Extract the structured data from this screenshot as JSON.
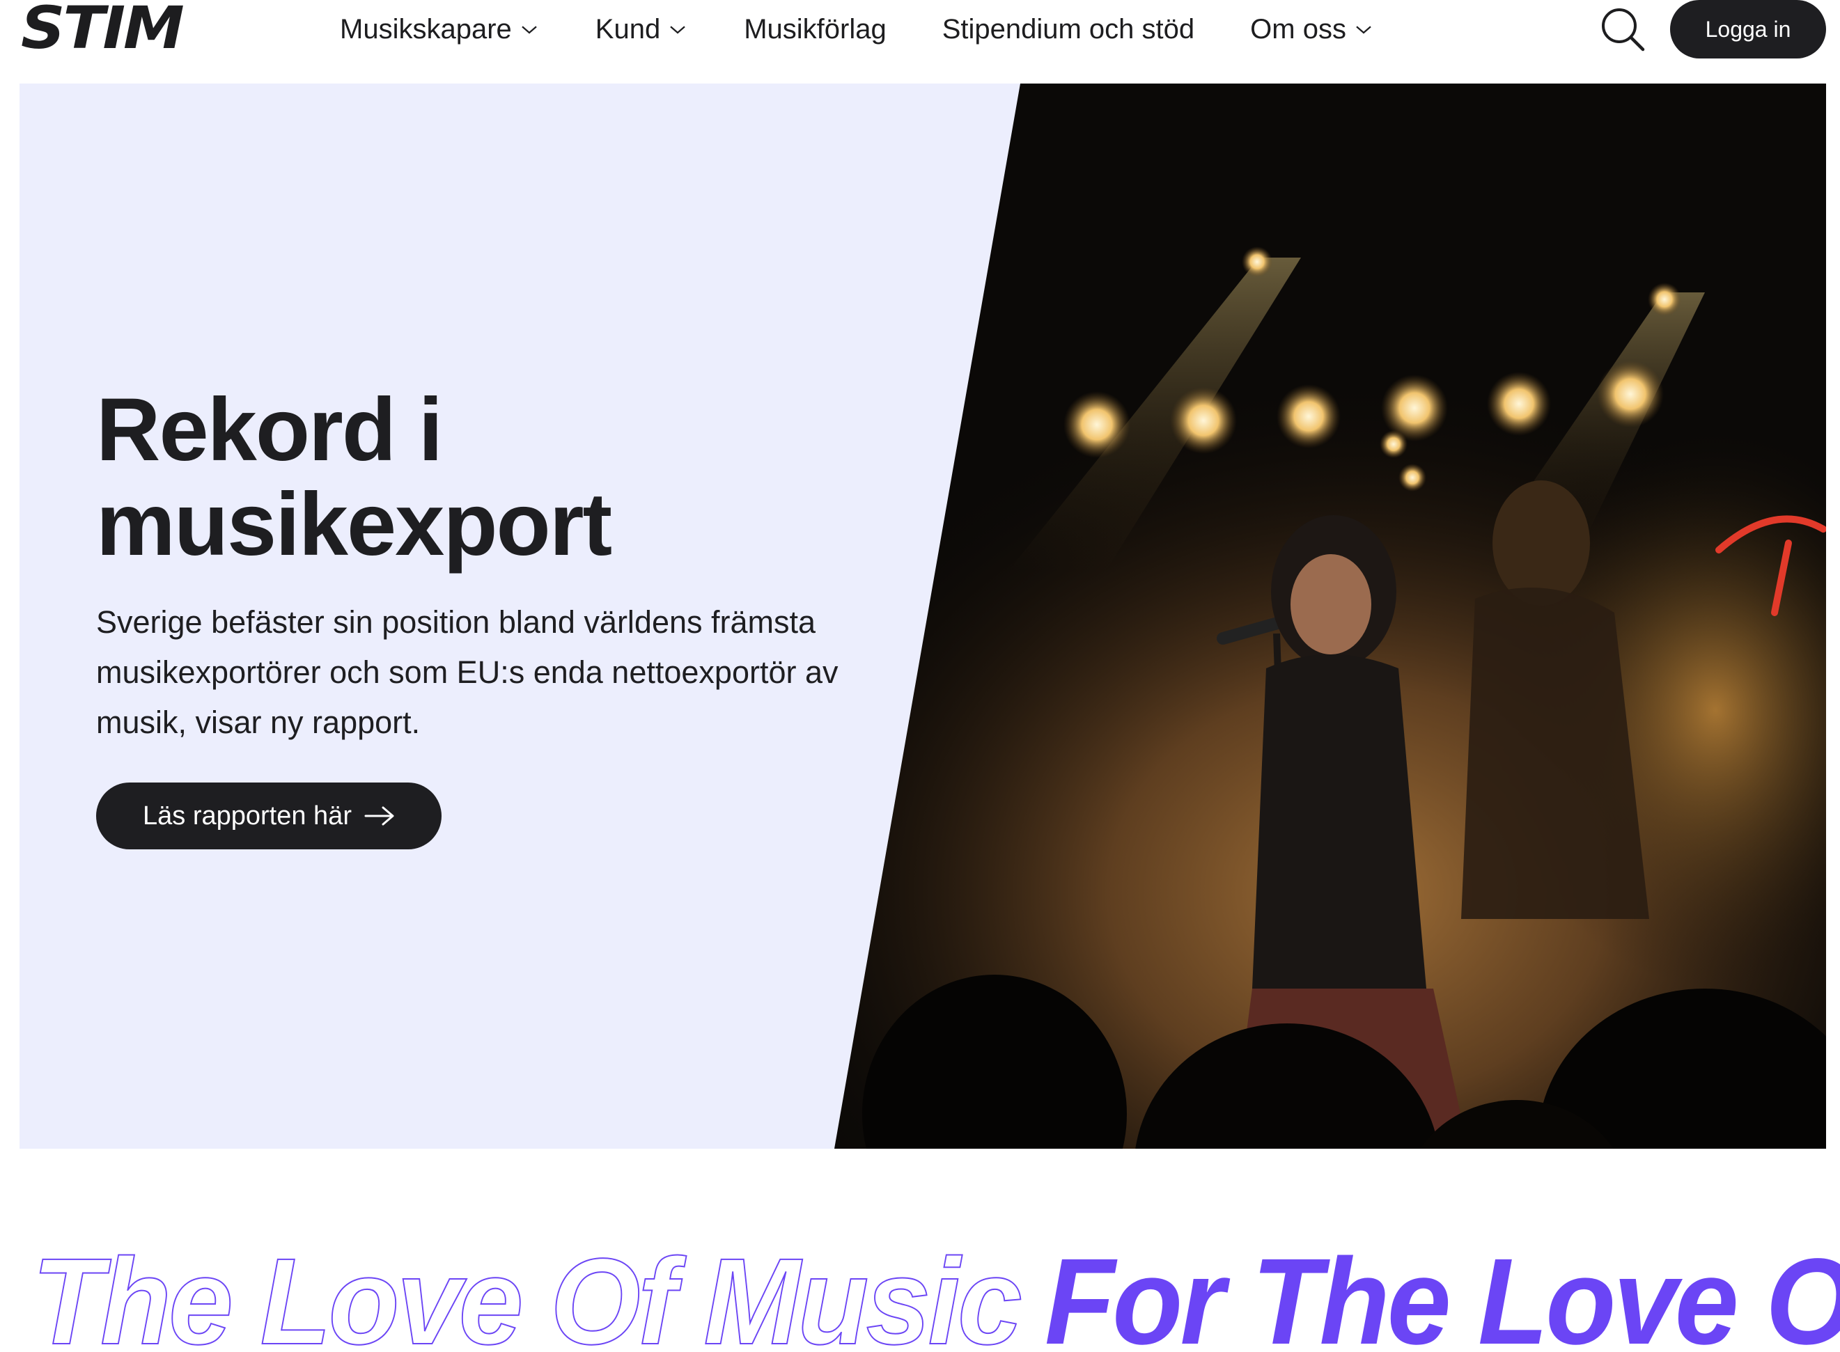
{
  "header": {
    "logo": "STIM",
    "nav": [
      {
        "label": "Musikskapare",
        "has_dropdown": true
      },
      {
        "label": "Kund",
        "has_dropdown": true
      },
      {
        "label": "Musikförlag",
        "has_dropdown": false
      },
      {
        "label": "Stipendium och stöd",
        "has_dropdown": false
      },
      {
        "label": "Om oss",
        "has_dropdown": true
      }
    ],
    "search_icon": "search-icon",
    "login_label": "Logga in"
  },
  "hero": {
    "title": "Rekord i musikexport",
    "text": "Sverige befäster sin position bland världens främsta musikexportörer och som EU:s enda nettoexportör av musik, visar ny rapport.",
    "cta_label": "Läs rapporten här",
    "cta_icon": "arrow-right-icon",
    "image_subject": "singer-on-stage-photo",
    "background_color": "#eceefd"
  },
  "marquee": {
    "outline_text": "The Love Of Music",
    "filled_text": "For The Love O",
    "accent_color": "#6b45f5"
  },
  "colors": {
    "dark": "#1e1e21",
    "accent": "#6b45f5"
  }
}
